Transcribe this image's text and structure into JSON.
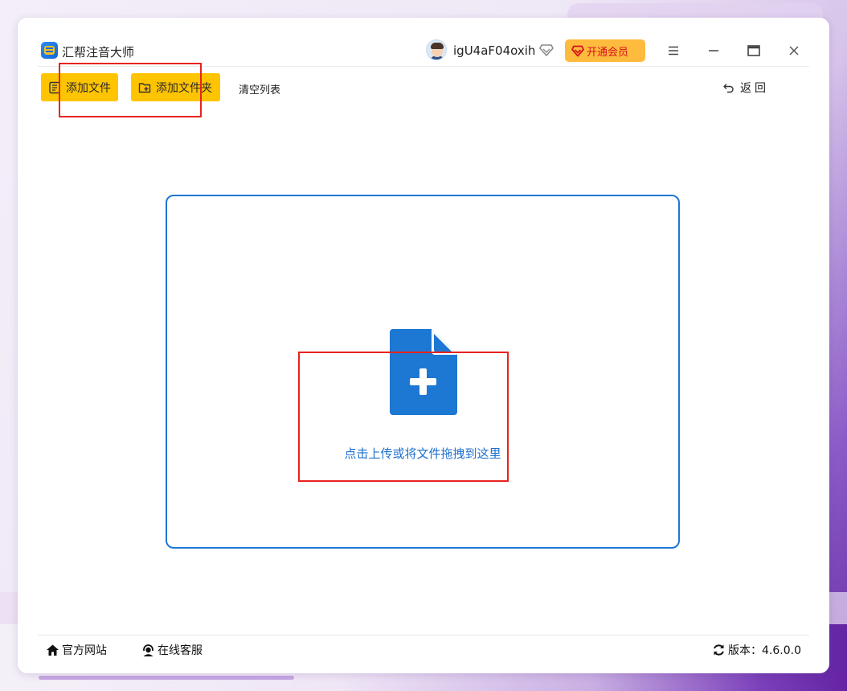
{
  "app": {
    "title": "汇帮注音大师",
    "username": "igU4aF04oxih",
    "vip_label": "开通会员"
  },
  "toolbar": {
    "add_file_label": "添加文件",
    "add_folder_label": "添加文件夹",
    "clear_list_label": "清空列表",
    "back_label": "返回"
  },
  "dropzone": {
    "text": "点击上传或将文件拖拽到这里"
  },
  "footer": {
    "website_label": "官方网站",
    "service_label": "在线客服",
    "version_label": "版本：4.6.0.0"
  },
  "colors": {
    "accent_yellow": "#ffc400",
    "vip_orange": "#ffbb3d",
    "primary_blue": "#1d78d4",
    "annotation_red": "#e8231f"
  },
  "icons": {
    "app_logo": "app-logo-icon",
    "vip_diamond": "diamond-icon",
    "menu": "menu-icon",
    "minimize": "minimize-icon",
    "maximize": "maximize-icon",
    "close": "close-icon",
    "add_file": "file-list-icon",
    "add_folder": "folder-add-icon",
    "back": "back-arrow-icon",
    "upload": "document-plus-icon",
    "website": "home-icon",
    "service": "headset-icon",
    "version": "refresh-icon"
  }
}
